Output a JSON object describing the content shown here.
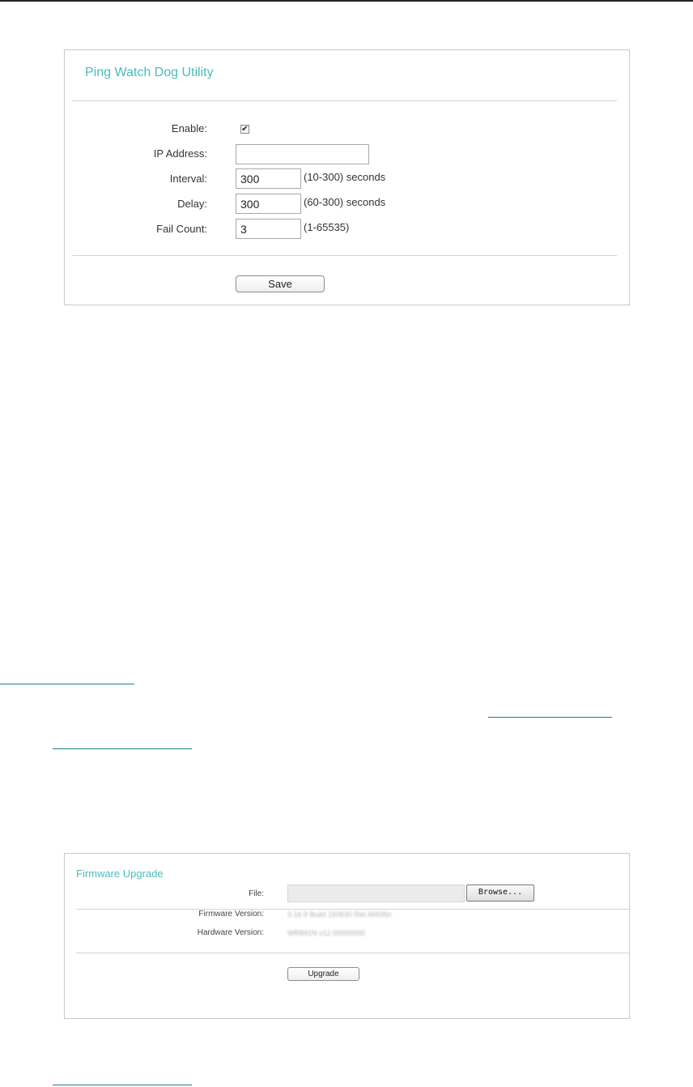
{
  "ping_panel": {
    "title": "Ping Watch Dog Utility",
    "fields": {
      "enable": {
        "label": "Enable:",
        "checked": true,
        "check_glyph": "✔"
      },
      "ip_address": {
        "label": "IP Address:",
        "value": ""
      },
      "interval": {
        "label": "Interval:",
        "value": "300",
        "hint": "(10-300) seconds"
      },
      "delay": {
        "label": "Delay:",
        "value": "300",
        "hint": "(60-300) seconds"
      },
      "fail_count": {
        "label": "Fail Count:",
        "value": "3",
        "hint": "(1-65535)"
      }
    },
    "save_label": "Save"
  },
  "firmware_panel": {
    "title": "Firmware Upgrade",
    "file_label": "File:",
    "browse_label": "Browse...",
    "firmware_version_label": "Firmware Version:",
    "firmware_version_value": "3.16.9 Build 160630 Rel.46935n",
    "hardware_version_label": "Hardware Version:",
    "hardware_version_value": "WR841N v12 00000000",
    "upgrade_label": "Upgrade"
  },
  "colors": {
    "title_accent": "#4bbcbc",
    "link": "#1a7f8c",
    "border": "#c8c8c8"
  },
  "icons": {
    "checkbox": "checkmark-icon"
  }
}
